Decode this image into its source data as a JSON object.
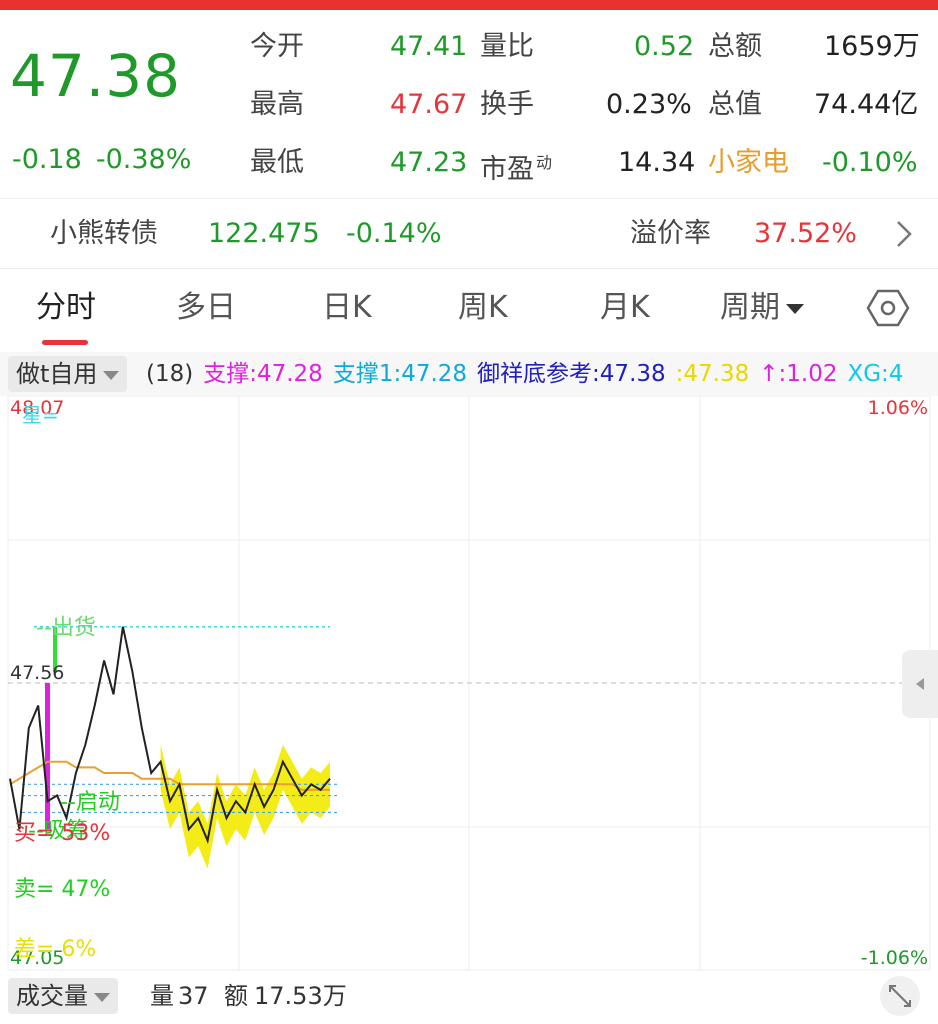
{
  "quote": {
    "price": "47.38",
    "change": "-0.18",
    "change_pct": "-0.38%",
    "fields": {
      "open_label": "今开",
      "open": "47.41",
      "high_label": "最高",
      "high": "47.67",
      "low_label": "最低",
      "low": "47.23",
      "vol_ratio_label": "量比",
      "vol_ratio": "0.52",
      "turnover_label": "换手",
      "turnover": "0.23%",
      "pe_label": "市盈",
      "pe_sup": "动",
      "pe": "14.34",
      "amount_label": "总额",
      "amount": "1659万",
      "mktcap_label": "总值",
      "mktcap": "74.44亿",
      "sector_label": "小家电",
      "sector_change": "-0.10%"
    }
  },
  "bond": {
    "name": "小熊转债",
    "price": "122.475",
    "change_pct": "-0.14%",
    "premium_label": "溢价率",
    "premium": "37.52%",
    "icon": "chevron-right-icon"
  },
  "tabs": {
    "items": [
      "分时",
      "多日",
      "日K",
      "周K",
      "月K",
      "周期"
    ],
    "active": "分时",
    "settings_icon": "hexagon-settings-icon"
  },
  "indicator": {
    "selector": "做t自用",
    "items": [
      {
        "text": "(18)",
        "color": "#333333"
      },
      {
        "text": "支撑:47.28",
        "color": "#e020e0"
      },
      {
        "text": "支撑1:47.28",
        "color": "#10a8d8"
      },
      {
        "text": "御祥底参考:47.38",
        "color": "#2020c0"
      },
      {
        "text": ":47.38",
        "color": "#e8d800"
      },
      {
        "text": "↑:1.02",
        "color": "#e020e0"
      },
      {
        "text": "XG:4",
        "color": "#10c8e8"
      }
    ]
  },
  "chart_data": {
    "type": "line",
    "y_axis_left": {
      "top": "48.07",
      "mid": "47.56",
      "bottom": "47.05"
    },
    "y_axis_right": {
      "top": "1.06%",
      "bottom": "-1.06%"
    },
    "ylim": [
      47.05,
      48.07
    ],
    "annotations": {
      "top_label": "星=",
      "sell_out": "出货",
      "start": "启动",
      "absorb": "吸筹",
      "buy_pct": "买= 53%",
      "sell_pct": "卖= 47%",
      "diff_pct": "差= 6%"
    },
    "series": [
      {
        "values": [
          47.39,
          47.3,
          47.48,
          47.52,
          47.35,
          47.36,
          47.32,
          47.4,
          47.45,
          47.52,
          47.6,
          47.54,
          47.66,
          47.58,
          47.48,
          47.4,
          47.42,
          47.35,
          47.38,
          47.3,
          47.32,
          47.28,
          47.37,
          47.32,
          47.35,
          47.33,
          47.38,
          47.34,
          47.37,
          47.42,
          47.39,
          47.36,
          47.38,
          47.37,
          47.39
        ]
      },
      {
        "values": [
          47.38,
          47.39,
          47.4,
          47.41,
          47.42,
          47.42,
          47.42,
          47.41,
          47.41,
          47.41,
          47.4,
          47.4,
          47.4,
          47.4,
          47.39,
          47.39,
          47.39,
          47.39,
          47.38,
          47.38,
          47.38,
          47.38,
          47.38,
          47.38,
          47.38,
          47.38,
          47.38,
          47.38,
          47.38,
          47.38,
          47.38,
          47.37,
          47.37,
          47.37,
          47.37
        ]
      }
    ]
  },
  "volume": {
    "selector": "成交量",
    "vol_label": "量",
    "vol": "37",
    "amt_label": "额",
    "amt": "17.53万",
    "expand_icon": "expand-icon"
  },
  "colors": {
    "up": "#e5353a",
    "down": "#1f9a2a",
    "price_line": "#222222",
    "avg_line": "#e8a032",
    "yellow": "#f2ea00",
    "accent_bar": "#e5353a"
  }
}
